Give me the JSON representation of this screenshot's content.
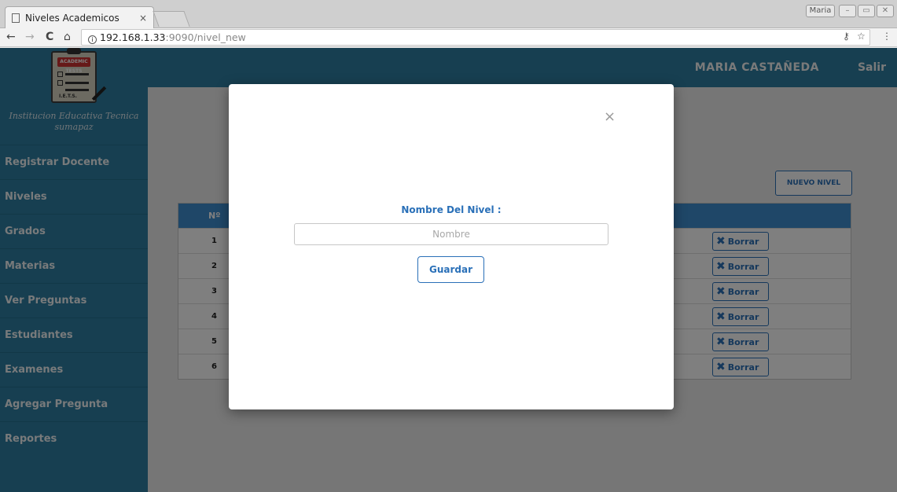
{
  "browser": {
    "tab_title": "Niveles Academicos",
    "tab_close": "×",
    "window_user": "Maria",
    "url_host": "192.168.1.33",
    "url_rest": ":9090/nivel_new",
    "info_icon": "i",
    "back": "←",
    "forward": "→",
    "reload": "C",
    "home": "⌂",
    "win_minimize": "–",
    "win_maximize": "▭",
    "win_close": "✕",
    "key_icon": "⚷",
    "star_icon": "☆",
    "menu_icon": "⋮"
  },
  "app": {
    "school_name_line1": "Institucion Educativa Tecnica",
    "school_name_line2": "sumapaz",
    "logo_badge": "ACADEMIC TESTS",
    "logo_inst": "I.E.T.S.",
    "user_name": "MARIA CASTAÑEDA",
    "logout": "Salir",
    "menu": [
      {
        "label": "Registrar Docente"
      },
      {
        "label": "Niveles"
      },
      {
        "label": "Grados"
      },
      {
        "label": "Materias"
      },
      {
        "label": "Ver Preguntas"
      },
      {
        "label": "Estudiantes"
      },
      {
        "label": "Examenes"
      },
      {
        "label": "Agregar Pregunta"
      },
      {
        "label": "Reportes"
      }
    ]
  },
  "table": {
    "new_button": "NUEVO NIVEL",
    "header_num": "Nº",
    "rows": [
      {
        "num": "1",
        "delete": "Borrar"
      },
      {
        "num": "2",
        "delete": "Borrar"
      },
      {
        "num": "3",
        "delete": "Borrar"
      },
      {
        "num": "4",
        "delete": "Borrar"
      },
      {
        "num": "5",
        "delete": "Borrar"
      },
      {
        "num": "6",
        "delete": "Borrar"
      }
    ],
    "delete_icon": "✖"
  },
  "modal": {
    "close": "×",
    "label": "Nombre Del Nivel :",
    "placeholder": "Nombre",
    "value": "",
    "save_button": "Guardar"
  },
  "colors": {
    "sidebar": "#2e7fa2",
    "table_header": "#3e8ed1",
    "accent": "#2a70b8"
  }
}
